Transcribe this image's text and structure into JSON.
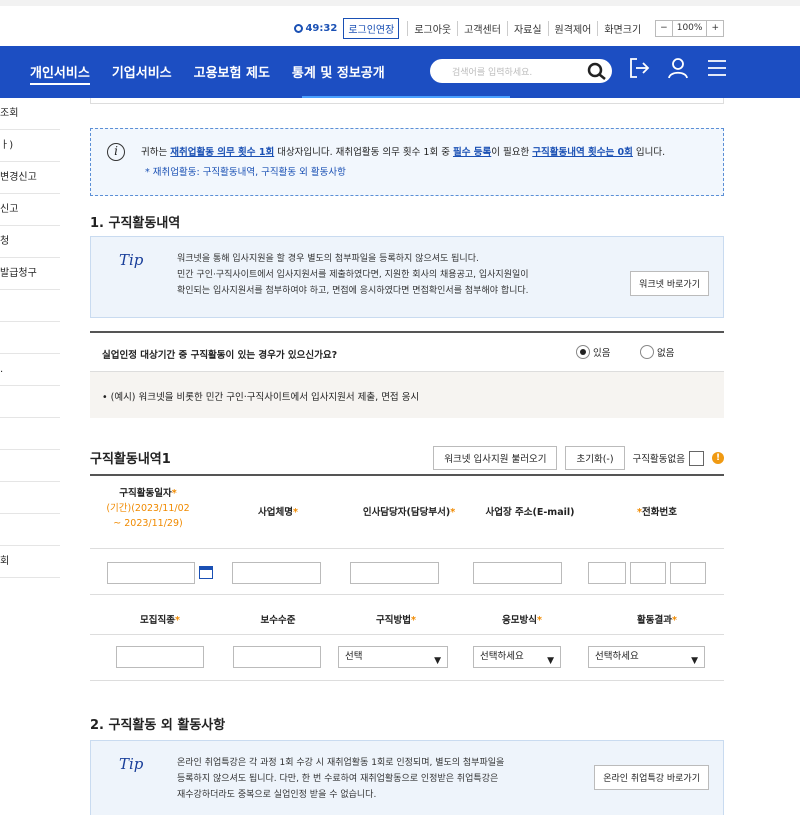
{
  "util": {
    "timer": "49:32",
    "extend": "로그인연장",
    "links": [
      "로그아웃",
      "고객센터",
      "자료실",
      "원격제어"
    ],
    "screen_size_label": "화면크기",
    "zoom_minus": "−",
    "zoom_value": "100%",
    "zoom_plus": "+"
  },
  "nav": {
    "items": [
      "개인서비스",
      "기업서비스",
      "고용보험 제도",
      "통계 및 정보공개"
    ],
    "search_placeholder": "검색어를 입력하세요."
  },
  "sidebar": {
    "items": [
      "조회",
      "ㅏ)",
      "변경신고",
      "신고",
      "청",
      "발급청구",
      "",
      "",
      ".",
      "",
      "",
      "",
      "",
      "",
      "회"
    ]
  },
  "notice": {
    "pre": "귀하는 ",
    "u1": "재취업활동 의무 횟수 1회",
    "mid1": " 대상자입니다. 재취업활동 의무 횟수 1회 중 ",
    "u2": "필수 등록",
    "mid2": "이 필요한 ",
    "u3": "구직활동내역 횟수는 0회",
    "post": " 입니다.",
    "note": "* 재취업활동: 구직활동내역, 구직활동 외 활동사항"
  },
  "section1": {
    "title": "1. 구직활동내역",
    "tip_logo": "Tip",
    "tip_lines": [
      "워크넷을 통해 입사지원을 할 경우 별도의 첨부파일을 등록하지 않으셔도 됩니다.",
      "민간 구인·구직사이트에서 입사지원서를 제출하였다면, 지원한 회사의 채용공고, 입사지원일이",
      "확인되는 입사지원서를 첨부하여야 하고, 면접에 응시하였다면 면접확인서를 첨부해야 합니다."
    ],
    "tip_button": "워크넷 바로가기",
    "question": "실업인정 대상기간 중 구직활동이 있는 경우가 있으신가요?",
    "opt_yes": "있음",
    "opt_no": "없음",
    "example": "• (예시) 워크넷을 비롯한 민간 구인·구직사이트에서 입사지원서 제출, 면접 응시"
  },
  "list": {
    "title": "구직활동내역1",
    "btn_import": "워크넷 입사지원 불러오기",
    "btn_reset": "초기화(-)",
    "no_activity": "구직활동없음",
    "warn": "!",
    "h_date": "구직활동일자",
    "h_date_range": "(기간)(2023/11/02",
    "h_date_range2": "~ 2023/11/29)",
    "h_company": "사업체명",
    "h_manager": "인사담당자(담당부서)",
    "h_address": "사업장 주소(E-mail)",
    "h_phone": "전화번호",
    "h_job": "모집직종",
    "h_salary": "보수수준",
    "h_method": "구직방법",
    "h_apply": "응모방식",
    "h_result": "활동결과",
    "star": "*",
    "sel_method": "선택",
    "sel_apply": "선택하세요",
    "sel_result": "선택하세요"
  },
  "section2": {
    "title": "2. 구직활동 외 활동사항",
    "tip_logo": "Tip",
    "tip_lines": [
      "온라인 취업특강은 각 과정 1회 수강 시 재취업활동 1회로 인정되며, 별도의 첨부파일을",
      "등록하지 않으셔도 됩니다. 다만, 한 번 수료하여 재취업활동으로 인정받은 취업특강은",
      "재수강하더라도 중복으로 실업인정 받을 수 없습니다."
    ],
    "tip_button": "온라인 취업특강 바로가기"
  }
}
